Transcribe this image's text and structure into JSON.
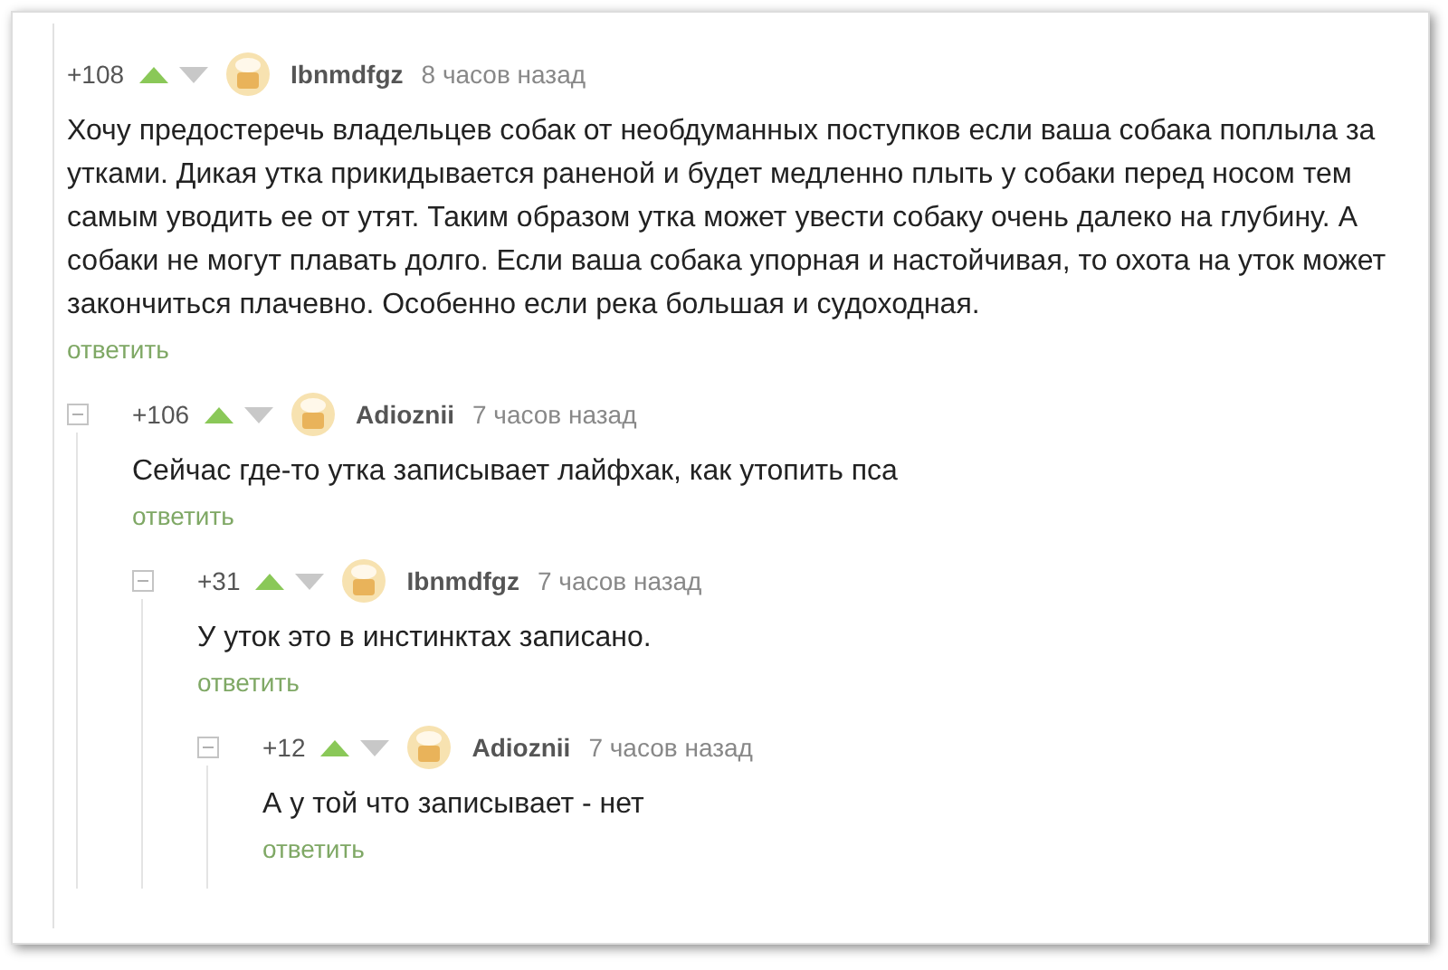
{
  "comments": [
    {
      "rating": "+108",
      "author": "Ibnmdfgz",
      "time": "8 часов назад",
      "text": "Хочу предостеречь владельцев собак от необдуманных поступков если ваша собака поплыла за утками. Дикая утка прикидывается раненой и будет медленно плыть у собаки перед носом тем самым уводить ее от утят. Таким образом утка может увести собаку очень далеко на глубину. А собаки не могут плавать долго. Если ваша собака упорная и настойчивая, то охота на уток может закончиться плачевно. Особенно если река большая и судоходная.",
      "reply": "ответить",
      "children": [
        {
          "rating": "+106",
          "author": "Adioznii",
          "time": "7 часов назад",
          "text": "Сейчас где-то утка записывает лайфхак, как утопить пса",
          "reply": "ответить",
          "children": [
            {
              "rating": "+31",
              "author": "Ibnmdfgz",
              "time": "7 часов назад",
              "text": "У уток это в инстинктах записано.",
              "reply": "ответить",
              "children": [
                {
                  "rating": "+12",
                  "author": "Adioznii",
                  "time": "7 часов назад",
                  "text": "А у той что записывает - нет",
                  "reply": "ответить"
                }
              ]
            }
          ]
        }
      ]
    }
  ]
}
